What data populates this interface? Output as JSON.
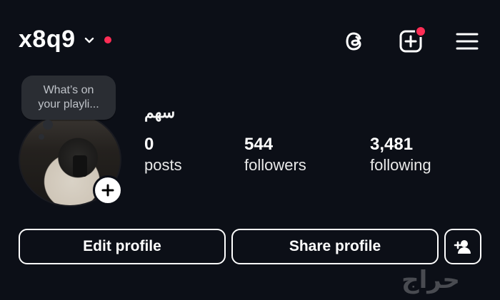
{
  "header": {
    "username": "x8q9",
    "icons": [
      "threads-icon",
      "create-icon",
      "menu-icon"
    ]
  },
  "profile": {
    "note_line1": "What’s on",
    "note_line2": "your playli...",
    "display_name": "سهم",
    "stats": [
      {
        "value": "0",
        "label": "posts"
      },
      {
        "value": "544",
        "label": "followers"
      },
      {
        "value": "3,481",
        "label": "following"
      }
    ]
  },
  "actions": {
    "edit_label": "Edit profile",
    "share_label": "Share profile"
  },
  "watermark": {
    "text": "حراج"
  },
  "colors": {
    "background": "#0c0f17",
    "text": "#ffffff",
    "notification": "#ff2d55",
    "note_bubble": "#2a2d33",
    "link": "#4c8dff"
  }
}
